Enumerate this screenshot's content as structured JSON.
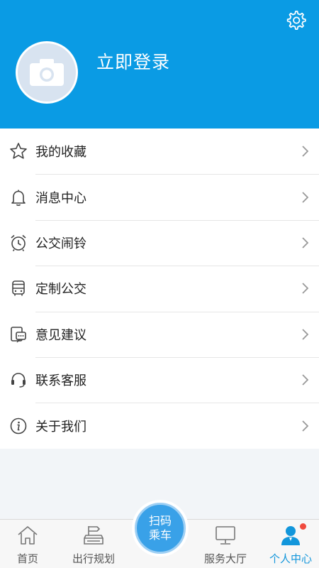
{
  "header": {
    "login_text": "立即登录",
    "bg_color": "#0a9be4",
    "settings_icon": "gear-icon",
    "avatar_icon": "camera-icon"
  },
  "menu": {
    "items": [
      {
        "label": "我的收藏",
        "icon": "star-icon"
      },
      {
        "label": "消息中心",
        "icon": "bell-icon"
      },
      {
        "label": "公交闹铃",
        "icon": "alarm-clock-icon"
      },
      {
        "label": "定制公交",
        "icon": "bus-icon"
      },
      {
        "label": "意见建议",
        "icon": "feedback-icon"
      },
      {
        "label": "联系客服",
        "icon": "headset-icon"
      },
      {
        "label": "关于我们",
        "icon": "info-icon"
      }
    ]
  },
  "tabbar": {
    "home": "首页",
    "plan": "出行规划",
    "scan_line1": "扫码",
    "scan_line2": "乘车",
    "service": "服务大厅",
    "profile": "个人中心",
    "active_color": "#1296db",
    "badge_color": "#f04a3e"
  }
}
